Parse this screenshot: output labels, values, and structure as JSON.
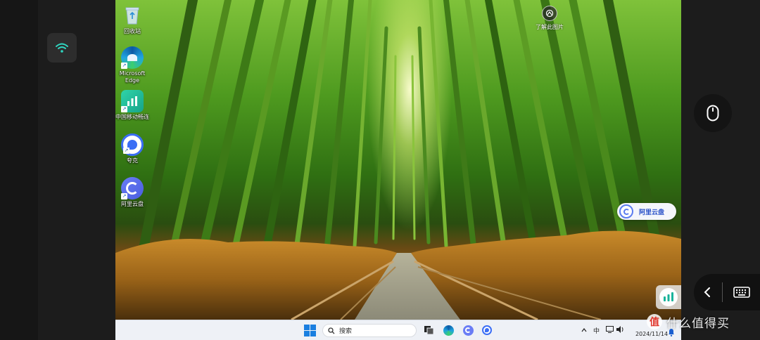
{
  "desktop": {
    "icons": [
      {
        "label": "回收站",
        "icon": "recycle-bin-icon"
      },
      {
        "label": "Microsoft Edge",
        "icon": "edge-icon"
      },
      {
        "label": "中国移动畅连",
        "icon": "china-mobile-icon"
      },
      {
        "label": "夸克",
        "icon": "quark-icon"
      },
      {
        "label": "阿里云盘",
        "icon": "aliyun-drive-icon"
      }
    ],
    "wallpaper_info_label": "了解此图片",
    "floating_widget_label": "阿里云盘"
  },
  "taskbar": {
    "search_placeholder": "搜索",
    "ime_indicator": "中",
    "date": "2024/11/14",
    "apps": [
      "task-view-icon",
      "edge-icon",
      "aliyun-drive-icon",
      "quark-icon"
    ]
  },
  "watermark": {
    "logo_char": "值",
    "text": "什么值得买"
  },
  "colors": {
    "taskbar_bg": "#eef1f6",
    "accent_blue": "#2850c8",
    "rail_bg": "#1c1c1c"
  }
}
